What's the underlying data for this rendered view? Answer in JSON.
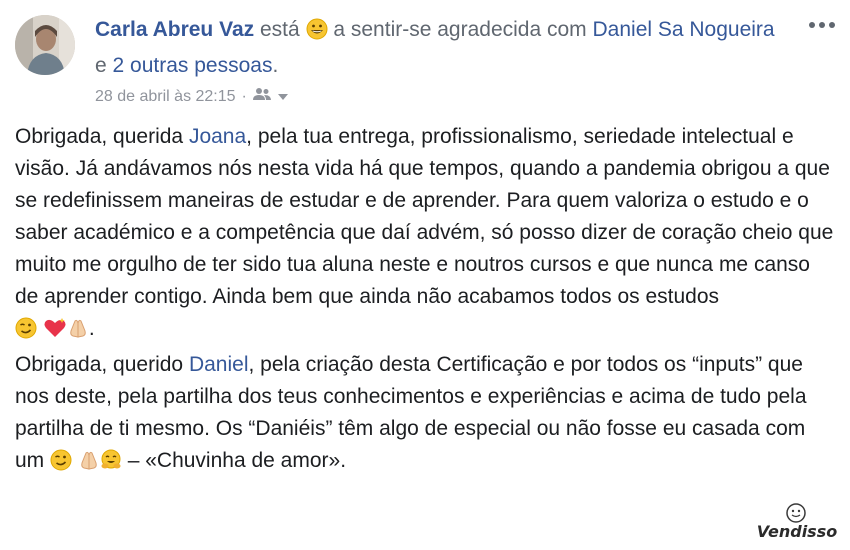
{
  "post": {
    "author": "Carla Abreu Vaz",
    "feeling_pre": "está",
    "feeling_text": "a sentir-se agradecida com",
    "tagged_person": "Daniel Sa Nogueira",
    "connector": "e",
    "others": "2 outras pessoas",
    "end_period": ".",
    "timestamp": "28 de abril às 22:15",
    "separator": "·",
    "audience_icon": "friends-icon"
  },
  "paragraph1": {
    "p1": "Obrigada, querida ",
    "mention": "Joana",
    "p2": ", pela tua entrega, profissionalismo, seriedade intelectual e visão. Já andávamos nós nesta vida há que tempos, quando a pandemia obrigou a que se redefinissem maneiras de estudar e de aprender. Para quem valoriza o estudo e o saber académico e a competência que daí advém, só posso dizer de coração cheio que muito me orgulho de ter sido tua aluna neste e noutros cursos e que nunca me canso de aprender contigo. Ainda bem que ainda não acabamos todos os estudos",
    "end": "."
  },
  "paragraph2": {
    "p1": "Obrigada, querido ",
    "mention": "Daniel",
    "p2": ", pela criação desta Certificação e por todos os “inputs” que nos deste, pela partilha dos teus conhecimentos e experiências e acima de tudo pela partilha de ti mesmo. Os “Daniéis” têm algo de especial ou não fosse eu casada com um",
    "p3": "– «Chuvinha de amor»."
  },
  "watermark": {
    "text": "Vendisso"
  },
  "colors": {
    "link": "#365899",
    "text": "#1c1e21",
    "meta": "#90949c"
  }
}
